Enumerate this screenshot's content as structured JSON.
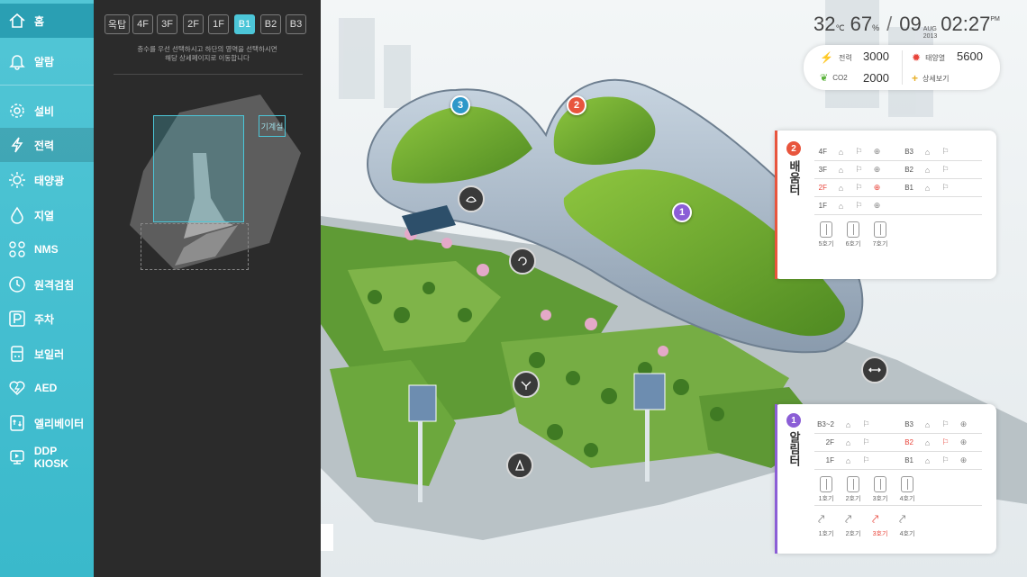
{
  "sidebar": {
    "items": [
      {
        "label": "홈",
        "icon": "home-icon"
      },
      {
        "label": "알람",
        "icon": "bell-icon"
      },
      {
        "label": "설비",
        "icon": "gear-icon"
      },
      {
        "label": "전력",
        "icon": "lightning-icon"
      },
      {
        "label": "태양광",
        "icon": "sun-icon"
      },
      {
        "label": "지열",
        "icon": "drop-icon"
      },
      {
        "label": "NMS",
        "icon": "network-icon"
      },
      {
        "label": "원격검침",
        "icon": "clock-icon"
      },
      {
        "label": "주차",
        "icon": "parking-icon"
      },
      {
        "label": "보일러",
        "icon": "boiler-icon"
      },
      {
        "label": "AED",
        "icon": "heart-icon"
      },
      {
        "label": "엘리베이터",
        "icon": "elevator-icon"
      },
      {
        "label": "DDP KIOSK",
        "icon": "kiosk-icon"
      }
    ]
  },
  "floors": {
    "buttons": [
      "옥탑",
      "4F",
      "3F",
      "2F",
      "1F",
      "B1",
      "B2",
      "B3"
    ],
    "selected": "B1",
    "note_line1": "층수를 우선 선택하시고 하단의 영역을 선택하시면",
    "note_line2": "해당 상세페이지로 이동합니다",
    "room_label": "기계실"
  },
  "status": {
    "temp": "32",
    "temp_unit": "℃",
    "humidity": "67",
    "humidity_unit": "%",
    "day": "09",
    "month": "AUG",
    "year": "2013",
    "time": "02:27",
    "ampm": "PM"
  },
  "info": {
    "power_label": "전력",
    "power_value": "3000",
    "solar_label": "태양열",
    "solar_value": "5600",
    "co2_label": "CO2",
    "co2_value": "2000",
    "detail_label": "상세보기"
  },
  "map_pins": [
    "1",
    "2",
    "3"
  ],
  "card2": {
    "number": "2",
    "title": "배움터",
    "rows_left": [
      "4F",
      "3F",
      "2F",
      "1F"
    ],
    "rows_right": [
      "B3",
      "B2",
      "B1"
    ],
    "elevators": [
      "5호기",
      "6호기",
      "7호기"
    ]
  },
  "card1": {
    "number": "1",
    "title": "알림터",
    "rows_left": [
      "B3~2",
      "2F",
      "1F"
    ],
    "rows_right": [
      "B3",
      "B2",
      "B1"
    ],
    "elevators": [
      "1호기",
      "2호기",
      "3호기",
      "4호기"
    ],
    "escalators": [
      "1호기",
      "2호기",
      "3호기",
      "4호기"
    ]
  },
  "colors": {
    "accent": "#4cc6d8",
    "alert": "#e8443a",
    "card2": "#e8553d",
    "card1": "#8b5ed6"
  }
}
